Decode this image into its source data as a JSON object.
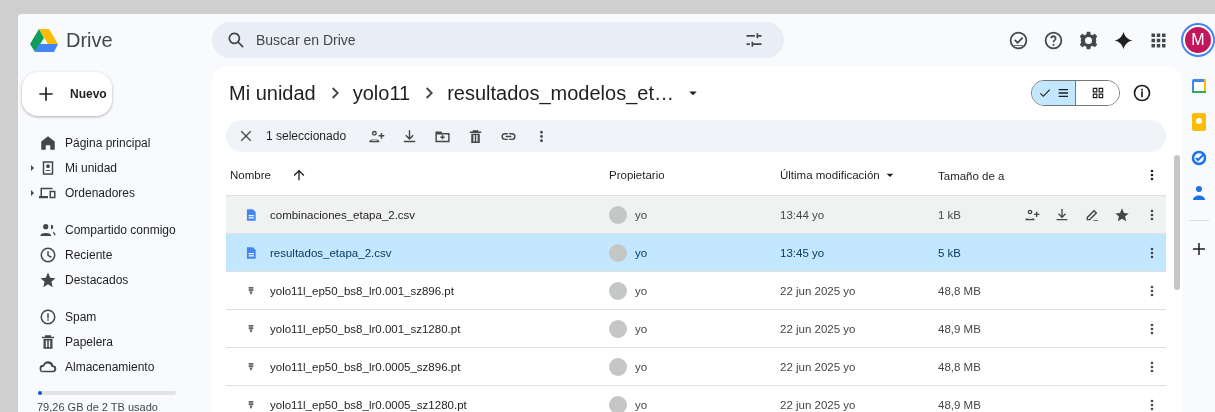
{
  "app": {
    "name": "Drive"
  },
  "search": {
    "placeholder": "Buscar en Drive"
  },
  "account": {
    "initial": "M"
  },
  "new_button": "Nuevo",
  "nav_groups": [
    [
      {
        "label": "Página principal",
        "expandable": false
      },
      {
        "label": "Mi unidad",
        "expandable": true
      },
      {
        "label": "Ordenadores",
        "expandable": true
      }
    ],
    [
      {
        "label": "Compartido conmigo",
        "expandable": false
      },
      {
        "label": "Reciente",
        "expandable": false
      },
      {
        "label": "Destacados",
        "expandable": false
      }
    ],
    [
      {
        "label": "Spam",
        "expandable": false
      },
      {
        "label": "Papelera",
        "expandable": false
      },
      {
        "label": "Almacenamiento",
        "expandable": false
      }
    ]
  ],
  "storage": {
    "level": 0.02,
    "text": "79,26 GB de 2 TB usado"
  },
  "breadcrumb": [
    "Mi unidad",
    "yolo11",
    "resultados_modelos_et…"
  ],
  "view_toggle": [
    {
      "kind": "list",
      "selected": true
    },
    {
      "kind": "grid",
      "selected": false
    }
  ],
  "selection_bar": {
    "text": "1 seleccionado"
  },
  "table": {
    "columns": [
      {
        "label": "Nombre",
        "sorted": true,
        "descending": false
      },
      {
        "label": "Propietario",
        "sorted": false
      },
      {
        "label": "Última modificación",
        "sorted": true,
        "descending": true
      },
      {
        "label": "Tamaño de a",
        "sorted": false
      }
    ],
    "rows": [
      {
        "kind": "csv",
        "name": "combinaciones_etapa_2.csv",
        "owner": "yo",
        "modified": "13:44 yo",
        "size": "1 kB",
        "selected": false,
        "hovered": true
      },
      {
        "kind": "csv",
        "name": "resultados_etapa_2.csv",
        "owner": "yo",
        "modified": "13:45 yo",
        "size": "5 kB",
        "selected": true,
        "hovered": false
      },
      {
        "kind": "pt",
        "name": "yolo11l_ep50_bs8_lr0.001_sz896.pt",
        "owner": "yo",
        "modified": "22 jun 2025 yo",
        "size": "48,8 MB",
        "selected": false,
        "hovered": false
      },
      {
        "kind": "pt",
        "name": "yolo11l_ep50_bs8_lr0.001_sz1280.pt",
        "owner": "yo",
        "modified": "22 jun 2025 yo",
        "size": "48,9 MB",
        "selected": false,
        "hovered": false
      },
      {
        "kind": "pt",
        "name": "yolo11l_ep50_bs8_lr0.0005_sz896.pt",
        "owner": "yo",
        "modified": "22 jun 2025 yo",
        "size": "48,8 MB",
        "selected": false,
        "hovered": false
      },
      {
        "kind": "pt",
        "name": "yolo11l_ep50_bs8_lr0.0005_sz1280.pt",
        "owner": "yo",
        "modified": "22 jun 2025 yo",
        "size": "48,9 MB",
        "selected": false,
        "hovered": false
      }
    ]
  }
}
